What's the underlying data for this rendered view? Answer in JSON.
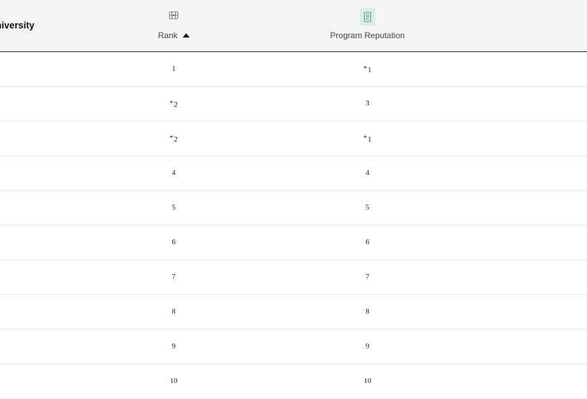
{
  "header": {
    "university_label": "niversity",
    "rank_label": "Rank",
    "rank_icon": "ranking-icon",
    "rank_sort": "ascending",
    "reputation_label": "Program Reputation",
    "reputation_icon": "reputation-book-icon"
  },
  "rows": [
    {
      "rank": "1",
      "rep": "1",
      "rank_tie": false,
      "rep_tie": true
    },
    {
      "rank": "2",
      "rep": "3",
      "rank_tie": true,
      "rep_tie": false
    },
    {
      "rank": "2",
      "rep": "1",
      "rank_tie": true,
      "rep_tie": true
    },
    {
      "rank": "4",
      "rep": "4",
      "rank_tie": false,
      "rep_tie": false
    },
    {
      "rank": "5",
      "rep": "5",
      "rank_tie": false,
      "rep_tie": false
    },
    {
      "rank": "6",
      "rep": "6",
      "rank_tie": false,
      "rep_tie": false
    },
    {
      "rank": "7",
      "rep": "7",
      "rank_tie": false,
      "rep_tie": false
    },
    {
      "rank": "8",
      "rep": "8",
      "rank_tie": false,
      "rep_tie": false
    },
    {
      "rank": "9",
      "rep": "9",
      "rank_tie": false,
      "rep_tie": false
    },
    {
      "rank": "10",
      "rep": "10",
      "rank_tie": false,
      "rep_tie": false
    }
  ],
  "tie_marker": "*",
  "colors": {
    "header_bg": "#f5f5f5",
    "icon_bg": "#d8ece7",
    "icon_accent": "#5aa89a"
  }
}
